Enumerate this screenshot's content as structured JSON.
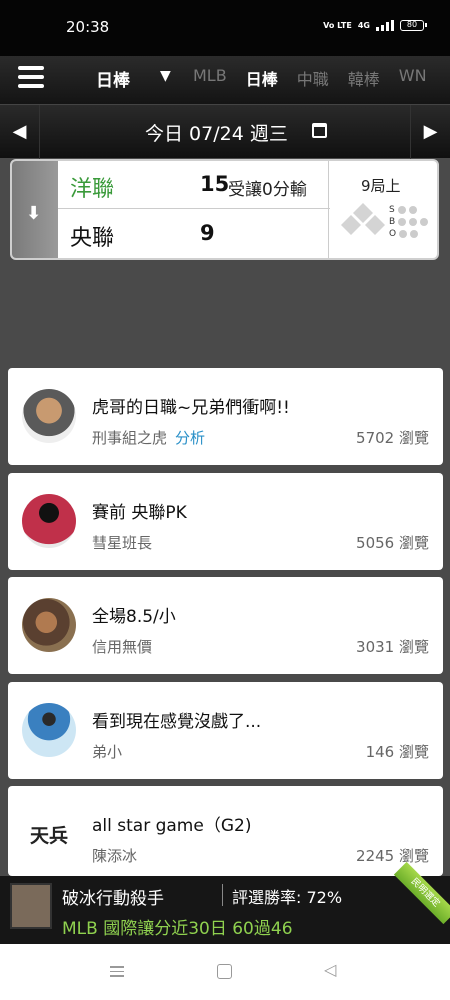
{
  "status_bar": {
    "time": "20:38",
    "network": "Vo LTE",
    "signal": "4G",
    "battery": "80"
  },
  "nav": {
    "selected_league": "日棒",
    "tabs": [
      {
        "label": "MLB",
        "active": false
      },
      {
        "label": "日棒",
        "active": true
      },
      {
        "label": "中職",
        "active": false
      },
      {
        "label": "韓棒",
        "active": false
      },
      {
        "label": "WN",
        "active": false
      }
    ]
  },
  "date_bar": {
    "label": "今日 07/24 週三"
  },
  "game": {
    "away": {
      "name": "洋聯",
      "score": "15",
      "spread": "受讓0分輸"
    },
    "home": {
      "name": "央聯",
      "score": "9"
    },
    "inning": "9局上",
    "sbo": [
      "S",
      "B",
      "O"
    ]
  },
  "posts": [
    {
      "title": "虎哥的日職~兄弟們衝啊!!",
      "author": "刑事組之虎",
      "tag": "分析",
      "views": "5702 瀏覽"
    },
    {
      "title": "賽前 央聯PK",
      "author": "彗星班長",
      "tag": "",
      "views": "5056 瀏覽"
    },
    {
      "title": "全場8.5/小",
      "author": "信用無價",
      "tag": "",
      "views": "3031 瀏覽"
    },
    {
      "title": "看到現在感覺沒戲了...",
      "author": "弟小",
      "tag": "",
      "views": "146 瀏覽"
    },
    {
      "title": "all star game（G2)",
      "author": "陳添冰",
      "tag": "",
      "views": "2245 瀏覽"
    }
  ],
  "avatar_5_text": "天兵",
  "promo": {
    "name": "破冰行動殺手",
    "rate": "評選勝率: 72%",
    "record": "MLB 國際讓分近30日 60過46",
    "ribbon": "民明選定"
  },
  "colors": {
    "accent_green": "#3a9a3a",
    "tag_blue": "#2a90c8",
    "promo_green": "#8fd14f"
  }
}
